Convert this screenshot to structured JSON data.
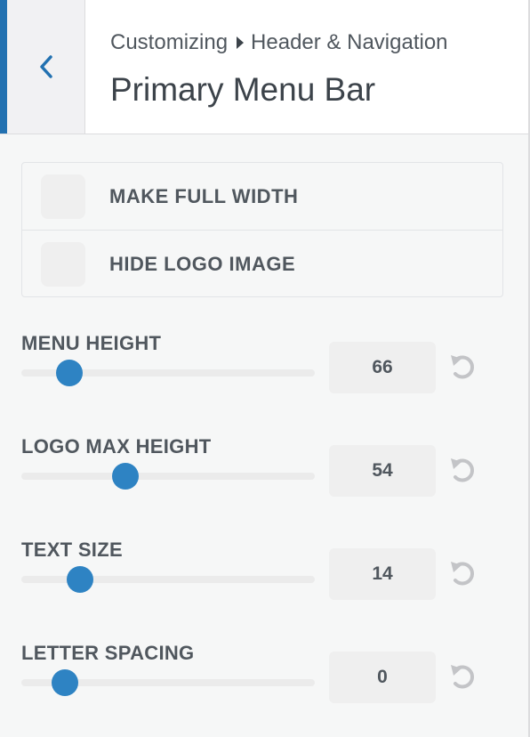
{
  "header": {
    "back_icon": "chevron-left-icon",
    "breadcrumb_root": "Customizing",
    "breadcrumb_separator_icon": "caret-right-icon",
    "breadcrumb_section": "Header & Navigation",
    "title": "Primary Menu Bar"
  },
  "options": [
    {
      "label": "MAKE FULL WIDTH",
      "checked": false
    },
    {
      "label": "HIDE LOGO IMAGE",
      "checked": false
    }
  ],
  "sliders": [
    {
      "label": "MENU HEIGHT",
      "value": "66",
      "fraction": 0.165
    },
    {
      "label": "LOGO MAX HEIGHT",
      "value": "54",
      "fraction": 0.355
    },
    {
      "label": "TEXT SIZE",
      "value": "14",
      "fraction": 0.2
    },
    {
      "label": "LETTER SPACING",
      "value": "0",
      "fraction": 0.148
    }
  ],
  "colors": {
    "accent": "#2271b1",
    "thumb": "#2e83c3",
    "reset_icon": "#c3c4c7"
  }
}
